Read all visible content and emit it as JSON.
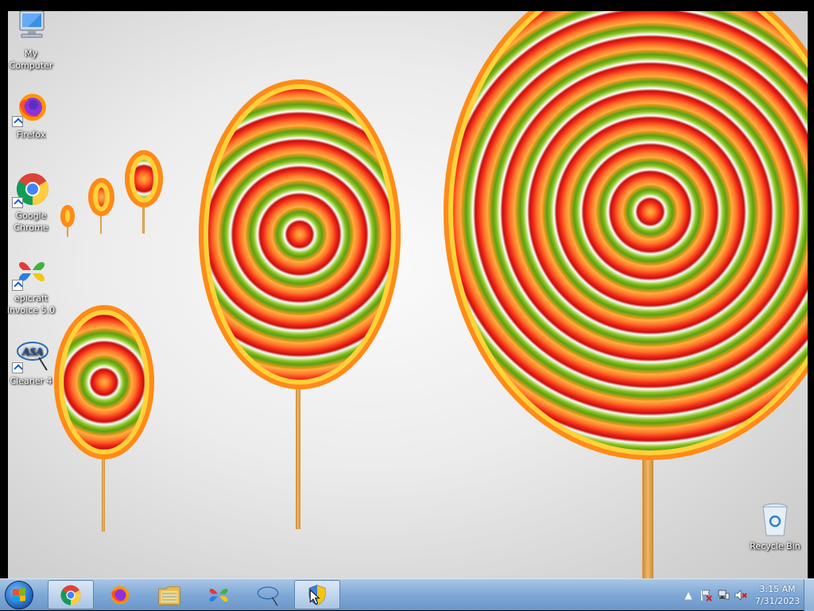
{
  "desktop": {
    "icons": [
      {
        "label": "My Computer"
      },
      {
        "label": "Firefox"
      },
      {
        "label": "Google Chrome"
      },
      {
        "label": "epicraft Invoice 5.0"
      },
      {
        "label": "Cleaner 4"
      },
      {
        "label": "Recycle Bin"
      }
    ],
    "cleaner_logo_text": "ASA"
  },
  "taskbar": {
    "pinned": [
      {
        "icon": "chrome-icon",
        "active": true
      },
      {
        "icon": "firefox-icon"
      },
      {
        "icon": "file-explorer-icon"
      },
      {
        "icon": "epicraft-icon"
      },
      {
        "icon": "cleaner-icon"
      },
      {
        "icon": "shield-cursor-icon",
        "active": true
      }
    ],
    "tray": {
      "icons": [
        "show-hidden-icons-chevron",
        "action-center-flag-icon",
        "network-icon",
        "volume-muted-icon"
      ],
      "time": "3:15 AM",
      "date": "7/31/2023"
    }
  },
  "colors": {
    "taskbar": "#7fa8d6",
    "lollipop_red": "#f02818",
    "lollipop_orange": "#ff9a1e",
    "lollipop_green": "#8cc21e"
  }
}
